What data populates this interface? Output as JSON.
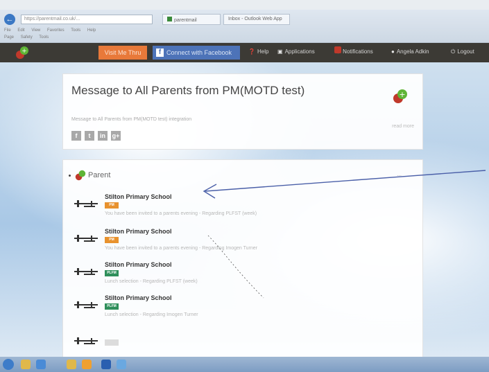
{
  "browser": {
    "url": "https://parentmail.co.uk/...",
    "tabs": [
      {
        "label": "parentmail"
      },
      {
        "label": "Inbox - Outlook Web App"
      }
    ],
    "menu": [
      "File",
      "Edit",
      "View",
      "Favorites",
      "Tools",
      "Help"
    ],
    "favorites": [
      "Page",
      "Safety",
      "Tools"
    ]
  },
  "nav": {
    "visit_label": "Visit Me Thru",
    "facebook_label": "Connect with Facebook",
    "help_label": "Help",
    "applications_label": "Applications",
    "notifications_label": "Notifications",
    "user_label": "Angela Adkin",
    "logout_label": "Logout"
  },
  "message": {
    "title": "Message to All Parents from PM(MOTD test)",
    "subtitle": "Message to All Parents from PM(MOTD test) integration",
    "more": "read more"
  },
  "social": [
    "f",
    "t",
    "in",
    "g+"
  ],
  "section": {
    "title": "Parent",
    "right": "..."
  },
  "items": [
    {
      "school": "Stilton Primary School",
      "tag": "PM",
      "tag_color": "#e8922e",
      "desc": "You have been invited to a parents evening - Regarding PLFST (week)"
    },
    {
      "school": "Stilton Primary School",
      "tag": "PM",
      "tag_color": "#e8922e",
      "desc": "You have been invited to a parents evening - Regarding Imogen Turner"
    },
    {
      "school": "Stilton Primary School",
      "tag": "PLFM",
      "tag_color": "#2f8f5b",
      "desc": "Lunch selection - Regarding PLFST (week)"
    },
    {
      "school": "Stilton Primary School",
      "tag": "PLFM",
      "tag_color": "#2f8f5b",
      "desc": "Lunch selection - Regarding Imogen Turner"
    },
    {
      "school": "",
      "tag": "",
      "tag_color": "#bbbbbb",
      "desc": ""
    }
  ],
  "colors": {
    "nav_bg": "#3c3a35",
    "visit_btn": "#e8793a",
    "facebook_btn": "#4d73b8",
    "logo_green": "#5fb536",
    "logo_red": "#c0392b"
  }
}
